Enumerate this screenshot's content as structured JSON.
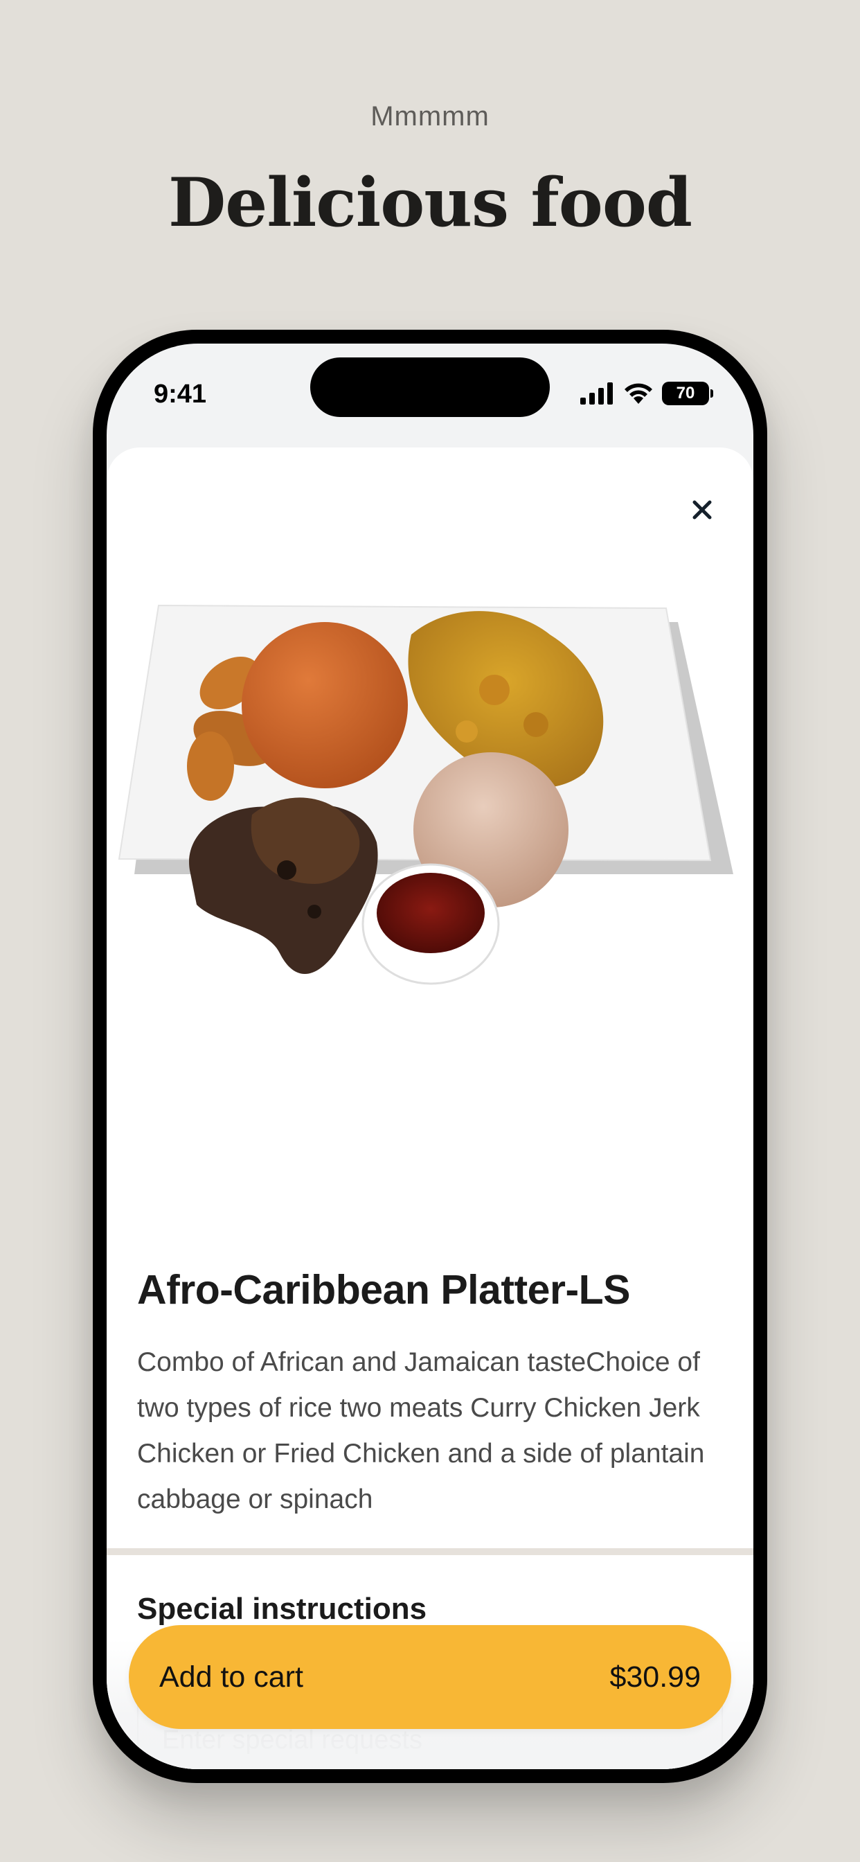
{
  "header": {
    "eyebrow": "Mmmmm",
    "headline": "Delicious food"
  },
  "statusbar": {
    "time": "9:41",
    "battery": "70",
    "icons": [
      "signal-icon",
      "wifi-icon",
      "battery-icon"
    ]
  },
  "sheet": {
    "close_icon": "close-icon",
    "image": "food-platter-image",
    "product": {
      "title": "Afro-Caribbean Platter-LS",
      "description": "Combo of African and Jamaican tasteChoice of two types of rice two meats Curry Chicken Jerk Chicken or Fried Chicken and a side of plantain cabbage or spinach"
    },
    "special_instructions": {
      "title": "Special instructions",
      "placeholder": "Enter special requests"
    },
    "cart_button": {
      "label": "Add to cart",
      "price": "$30.99"
    }
  },
  "colors": {
    "background": "#e2dfd9",
    "accent": "#f8b735",
    "text": "#1b1b1b"
  }
}
